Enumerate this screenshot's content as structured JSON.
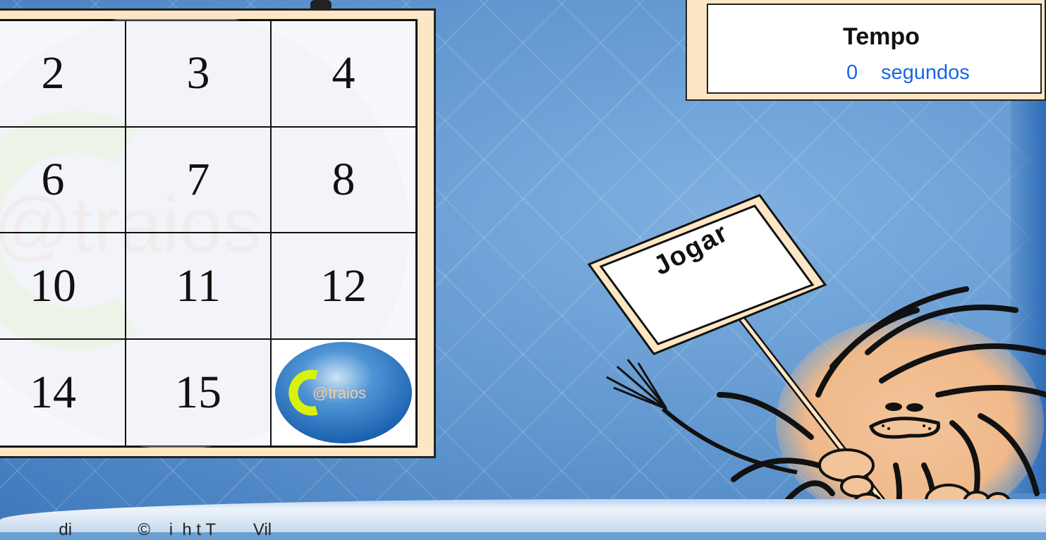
{
  "timer": {
    "title": "Tempo",
    "value": "0",
    "unit": "segundos"
  },
  "board": {
    "tiles": [
      "2",
      "3",
      "4",
      "6",
      "7",
      "8",
      "10",
      "11",
      "12",
      "14",
      "15",
      ""
    ],
    "watermark": "@traios",
    "empty_tile_logo": "@traios"
  },
  "play_button": {
    "label": "Jogar"
  },
  "footer": {
    "text": "     di              ©    i  h t T        Vil"
  },
  "colors": {
    "background": "#6a9fd4",
    "frame": "#fde6c3",
    "timer_text": "#1b66e0"
  }
}
